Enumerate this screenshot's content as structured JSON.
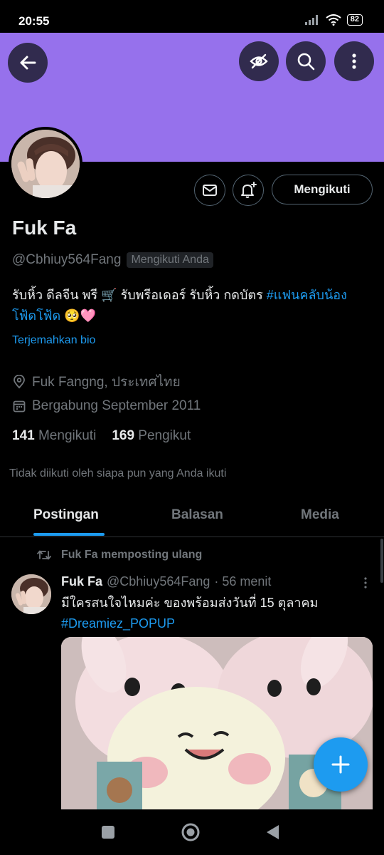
{
  "status_bar": {
    "time": "20:55",
    "battery": "82"
  },
  "header": {
    "banner_color": "#9671ec"
  },
  "profile": {
    "name": "Fuk Fa",
    "handle": "@Cbhiuy564Fang",
    "follows_you_badge": "Mengikuti Anda",
    "follow_button_label": "Mengikuti",
    "bio_text": "รับหิ้ว ดีลจีน พรี 🛒 รับพรีอเดอร์ รับหิ้ว กดบัตร ",
    "bio_hashtag": "#แฟนคลับน้องโฟ้ดโฟ้ด",
    "bio_emoji": " 🥺🩷",
    "translate_label": "Terjemahkan bio",
    "location": "Fuk Fangng, ประเทศไทย",
    "joined": "Bergabung September 2011",
    "following_count": "141",
    "following_label": "Mengikuti",
    "followers_count": "169",
    "followers_label": "Pengikut",
    "not_followed_note": "Tidak diikuti oleh siapa pun yang Anda ikuti"
  },
  "tabs": [
    {
      "label": "Postingan",
      "active": true
    },
    {
      "label": "Balasan",
      "active": false
    },
    {
      "label": "Media",
      "active": false
    }
  ],
  "tweet": {
    "repost_label": "Fuk Fa memposting ulang",
    "author_name": "Fuk Fa",
    "author_handle": "@Cbhiuy564Fang",
    "time_ago": "· 56 menit",
    "text": "มีใครสนใจไหมค่ะ  ของพร้อมส่งวันที่ 15 ตุลาคม",
    "hashtag": "#Dreamiez_POPUP"
  },
  "icons": {
    "back": "arrow-left-icon",
    "hide": "eye-slash-icon",
    "search": "search-icon",
    "more": "more-vertical-icon",
    "message": "envelope-icon",
    "notify": "bell-plus-icon",
    "location": "location-pin-icon",
    "calendar": "calendar-icon",
    "repost": "repost-icon",
    "compose": "plus-icon"
  },
  "colors": {
    "accent": "#1d9bf0",
    "background": "#000000",
    "muted_text": "#71767b"
  }
}
